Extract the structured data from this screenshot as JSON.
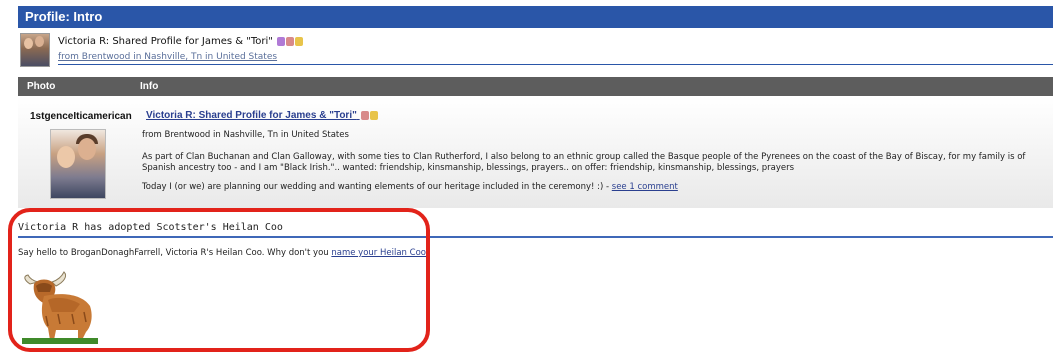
{
  "titlebar": {
    "title": "Profile: Intro"
  },
  "header": {
    "name": "Victoria R: Shared Profile for James & \"Tori\"",
    "location": "from Brentwood in Nashville, Tn in United States",
    "emoji_icons": [
      "person-icon",
      "flag-icon",
      "sun-icon"
    ]
  },
  "table": {
    "columns": [
      "Photo",
      "Info"
    ],
    "username": "1stgenceIticamerican",
    "title": "Victoria R: Shared Profile for James & \"Tori\"",
    "location": "from Brentwood in Nashville, Tn in United States",
    "description": "As part of Clan Buchanan and Clan Galloway, with some ties to Clan Rutherford, I also belong to an ethnic group called the Basque people of the Pyrenees on the coast of the Bay of Biscay, for my family is of Spanish ancestry too - and I am \"Black Irish.\".. wanted: friendship, kinsmanship, blessings, prayers.. on offer: friendship, kinsmanship, blessings, prayers",
    "today_text": "Today I (or we) are planning our wedding and wanting elements of our heritage included in the ceremony! :) - ",
    "comment_link": "see 1 comment"
  },
  "adopt": {
    "heading": "Victoria R has adopted Scotster's Heilan Coo",
    "hello_prefix": "Say hello to BroganDonaghFarrell, Victoria R's Heilan Coo. Why don't you ",
    "hello_link": "name your Heilan Coo",
    "hello_suffix": "?"
  },
  "colors": {
    "titlebar": "#2a56a8",
    "table_header": "#5d5d5d",
    "link": "#2a3f8f",
    "highlight": "#e2231a"
  }
}
